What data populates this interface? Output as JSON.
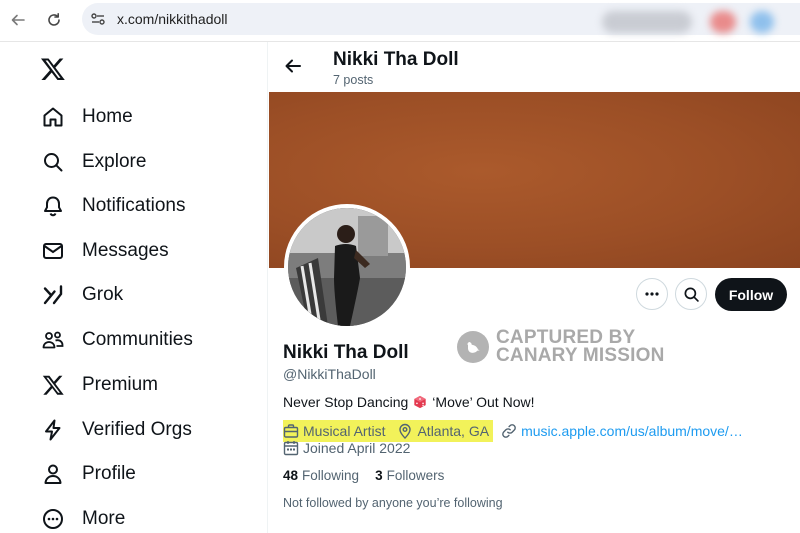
{
  "browser": {
    "url": "x.com/nikkithadoll",
    "icons": {
      "back": "back-arrow-icon",
      "reload": "reload-icon",
      "site": "site-settings-icon"
    }
  },
  "sidebar": {
    "logo": "x-logo-icon",
    "items": [
      {
        "label": "Home",
        "icon": "home-icon"
      },
      {
        "label": "Explore",
        "icon": "search-icon"
      },
      {
        "label": "Notifications",
        "icon": "bell-icon"
      },
      {
        "label": "Messages",
        "icon": "envelope-icon"
      },
      {
        "label": "Grok",
        "icon": "grok-icon"
      },
      {
        "label": "Communities",
        "icon": "people-icon"
      },
      {
        "label": "Premium",
        "icon": "x-icon"
      },
      {
        "label": "Verified Orgs",
        "icon": "lightning-icon"
      },
      {
        "label": "Profile",
        "icon": "person-icon"
      },
      {
        "label": "More",
        "icon": "more-circle-icon"
      }
    ]
  },
  "header": {
    "name": "Nikki Tha Doll",
    "posts": "7 posts"
  },
  "profile": {
    "name": "Nikki Tha Doll",
    "handle": "@NikkiThaDoll",
    "bio_before": "Never Stop Dancing",
    "bio_after": "‘Move’ Out Now!",
    "category": "Musical Artist",
    "location": "Atlanta, GA",
    "link": "music.apple.com/us/album/move/…",
    "joined": "Joined April 2022",
    "following_count": "48",
    "following_label": "Following",
    "followers_count": "3",
    "followers_label": "Followers",
    "not_followed": "Not followed by anyone you’re following"
  },
  "actions": {
    "follow_label": "Follow"
  },
  "watermark": {
    "line1": "CAPTURED BY",
    "line2": "CANARY MISSION"
  },
  "colors": {
    "banner": "#9c4f26",
    "highlight": "#f2f25a",
    "link": "#1d9bf0",
    "follow_button": "#0f1419",
    "muted_text": "#536471"
  }
}
